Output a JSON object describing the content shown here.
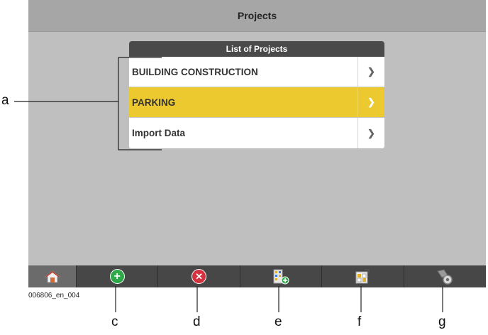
{
  "titlebar": {
    "title": "Projects"
  },
  "list": {
    "header": "List of Projects",
    "items": [
      {
        "label": "BUILDING CONSTRUCTION",
        "selected": false
      },
      {
        "label": "PARKING",
        "selected": true
      },
      {
        "label": "Import Data",
        "selected": false
      }
    ],
    "chevron": "❯"
  },
  "toolbar": {
    "buttons": [
      {
        "name": "home",
        "icon": "home-icon"
      },
      {
        "name": "add",
        "icon": "add-icon"
      },
      {
        "name": "delete",
        "icon": "delete-icon"
      },
      {
        "name": "import",
        "icon": "import-data-icon"
      },
      {
        "name": "edit",
        "icon": "edit-project-icon"
      },
      {
        "name": "settings",
        "icon": "settings-icon"
      }
    ]
  },
  "callouts": {
    "a": "a",
    "c": "c",
    "d": "d",
    "e": "e",
    "f": "f",
    "g": "g"
  },
  "caption": "006806_en_004",
  "colors": {
    "selected": "#ebc92f",
    "add": "#2fa84a",
    "delete": "#d4323e",
    "toolbar": "#474747",
    "background": "#bfbfbf"
  }
}
